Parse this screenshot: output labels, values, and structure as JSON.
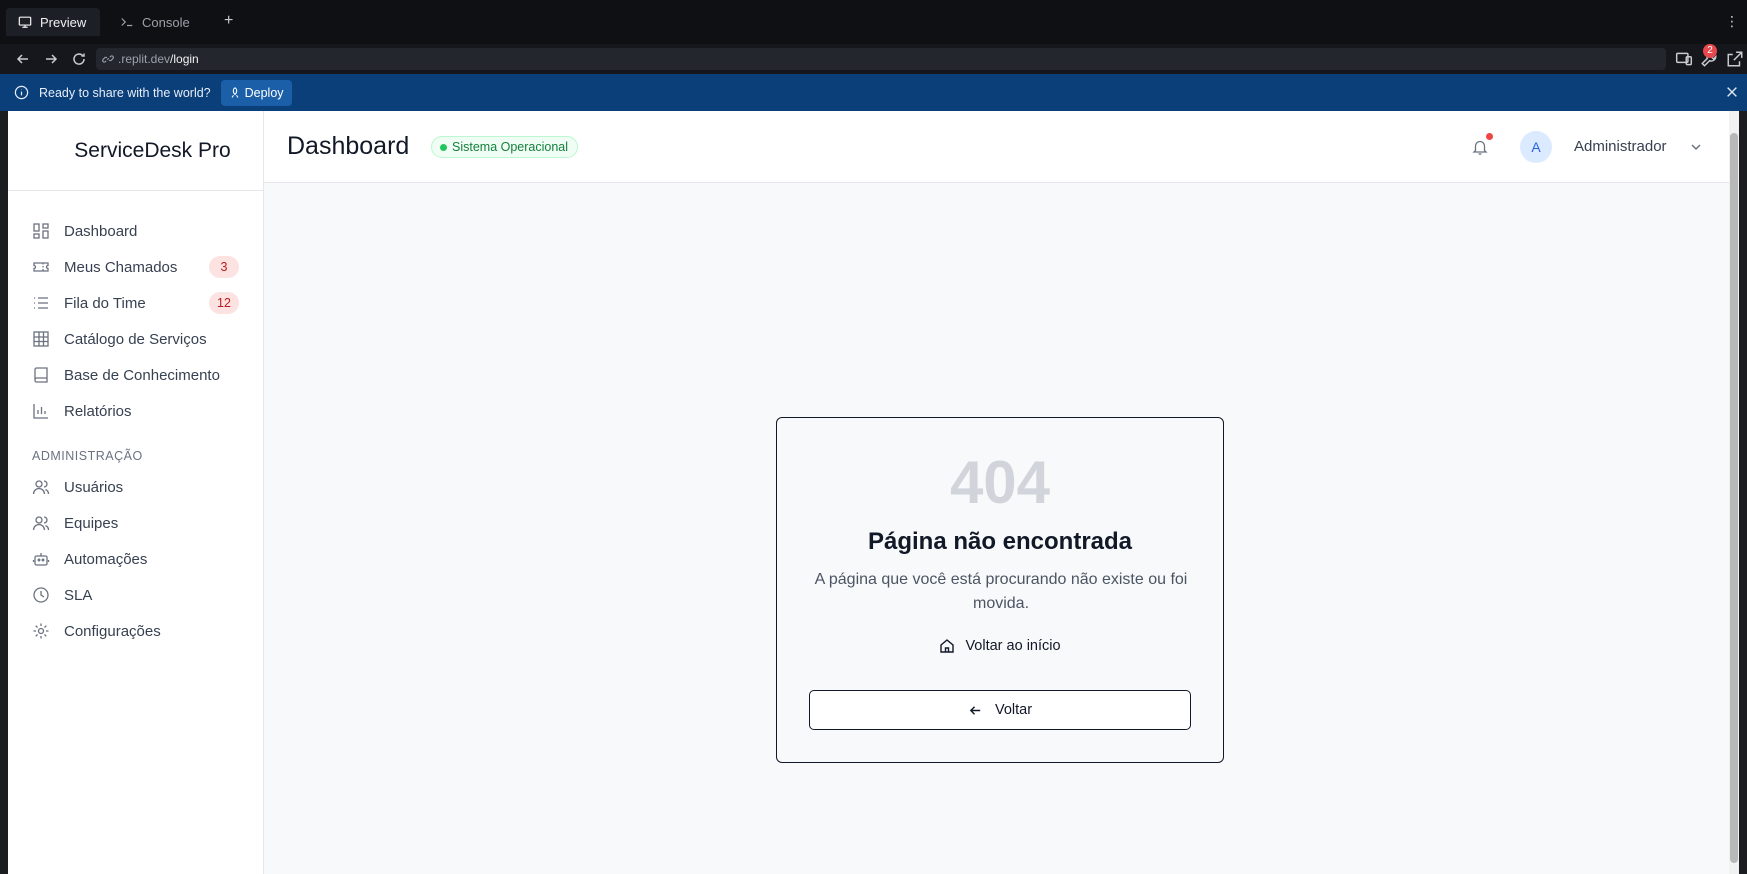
{
  "ide": {
    "tabs": [
      {
        "label": "Preview",
        "icon": "monitor-icon"
      },
      {
        "label": "Console",
        "icon": "terminal-icon"
      }
    ],
    "add_tab": "+",
    "url": {
      "domain": ".replit.dev",
      "path": "/login"
    },
    "notification_count": "2",
    "banner": {
      "message": "Ready to share with the world?",
      "deploy_label": "Deploy"
    }
  },
  "app": {
    "brand": "ServiceDesk Pro",
    "menu": [
      {
        "label": "Dashboard",
        "icon": "grid-icon"
      },
      {
        "label": "Meus Chamados",
        "icon": "ticket-icon",
        "count": "3"
      },
      {
        "label": "Fila do Time",
        "icon": "list-icon",
        "count": "12"
      },
      {
        "label": "Catálogo de Serviços",
        "icon": "table-icon"
      },
      {
        "label": "Base de Conhecimento",
        "icon": "book-icon"
      },
      {
        "label": "Relatórios",
        "icon": "bar-chart-icon"
      }
    ],
    "admin_section": "ADMINISTRAÇÃO",
    "admin_menu": [
      {
        "label": "Usuários",
        "icon": "users-icon"
      },
      {
        "label": "Equipes",
        "icon": "team-icon"
      },
      {
        "label": "Automações",
        "icon": "bot-icon"
      },
      {
        "label": "SLA",
        "icon": "clock-icon"
      },
      {
        "label": "Configurações",
        "icon": "gear-icon"
      }
    ],
    "header": {
      "title": "Dashboard",
      "status": "Sistema Operacional",
      "avatar_initial": "A",
      "user_name": "Administrador"
    },
    "not_found": {
      "code": "404",
      "title": "Página não encontrada",
      "message": "A página que você está procurando não existe ou foi movida.",
      "home_label": "Voltar ao início",
      "back_label": "Voltar"
    }
  },
  "colors": {
    "banner": "#0b3f7a",
    "status_green": "#15803d",
    "badge_red": "#b91c1c"
  }
}
